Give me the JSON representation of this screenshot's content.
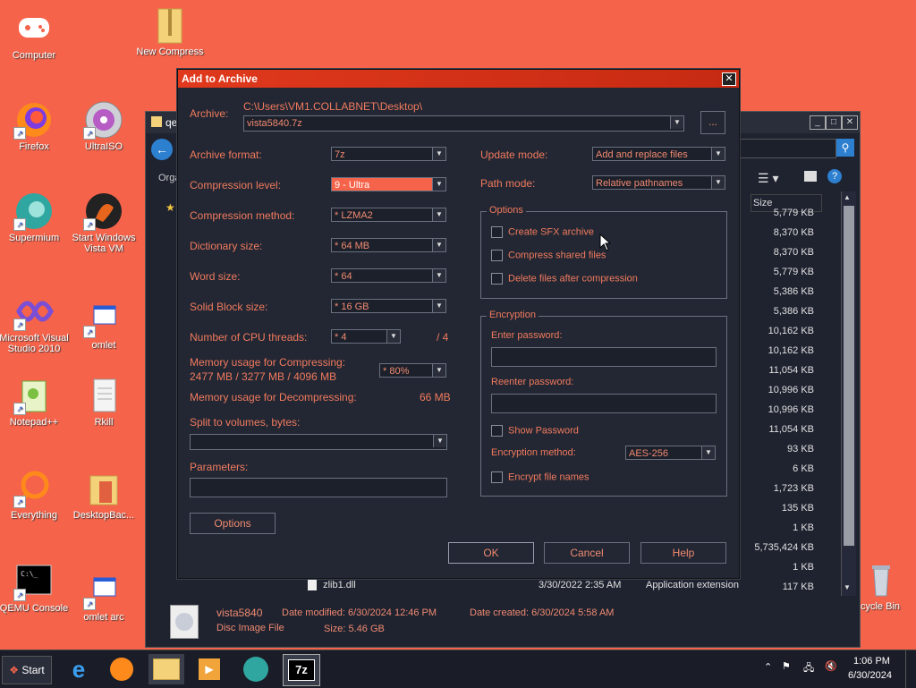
{
  "desktop": {
    "icons": [
      {
        "label": "Computer"
      },
      {
        "label": "New Compress"
      },
      {
        "label": "Firefox"
      },
      {
        "label": "UltraISO"
      },
      {
        "label": "Supermium"
      },
      {
        "label": "Start Windows Vista VM"
      },
      {
        "label": "Microsoft Visual Studio 2010"
      },
      {
        "label": "omlet"
      },
      {
        "label": "Notepad++"
      },
      {
        "label": "Rkill"
      },
      {
        "label": "Everything"
      },
      {
        "label": "DesktopBac..."
      },
      {
        "label": "QEMU Console"
      },
      {
        "label": "omlet arc"
      },
      {
        "label": "cycle Bin"
      }
    ]
  },
  "explorer": {
    "title": "qe",
    "column_size": "Size",
    "sizes": [
      "5,779 KB",
      "8,370 KB",
      "8,370 KB",
      "5,779 KB",
      "5,386 KB",
      "5,386 KB",
      "10,162 KB",
      "10,162 KB",
      "11,054 KB",
      "10,996 KB",
      "10,996 KB",
      "11,054 KB",
      "93 KB",
      "6 KB",
      "1,723 KB",
      "135 KB",
      "1 KB",
      "5,735,424 KB",
      "1 KB",
      "117 KB"
    ],
    "row_name": "zlib1.dll",
    "row_date": "3/30/2022 2:35 AM",
    "row_type": "Application extension",
    "details": {
      "name": "vista5840",
      "type": "Disc Image File",
      "modified": "Date modified: 6/30/2024 12:46 PM",
      "created": "Date created: 6/30/2024 5:58 AM",
      "size": "Size: 5.46 GB"
    },
    "nav_label": "Orga"
  },
  "dialog": {
    "title": "Add to Archive",
    "archive_label": "Archive:",
    "archive_path": "C:\\Users\\VM1.COLLABNET\\Desktop\\",
    "archive_name": "vista5840.7z",
    "browse_label": "...",
    "format_label": "Archive format:",
    "format_value": "7z",
    "level_label": "Compression level:",
    "level_value": "9 - Ultra",
    "method_label": "Compression method:",
    "method_value": "* LZMA2",
    "dict_label": "Dictionary size:",
    "dict_value": "* 64 MB",
    "word_label": "Word size:",
    "word_value": "* 64",
    "solid_label": "Solid Block size:",
    "solid_value": "* 16 GB",
    "threads_label": "Number of CPU threads:",
    "threads_value": "* 4",
    "threads_max": "/ 4",
    "mem_comp_label": "Memory usage for Compressing:",
    "mem_comp_value": "2477 MB / 3277 MB / 4096 MB",
    "mem_comp_pct": "* 80%",
    "mem_decomp_label": "Memory usage for Decompressing:",
    "mem_decomp_value": "66 MB",
    "split_label": "Split to volumes, bytes:",
    "params_label": "Parameters:",
    "options_btn": "Options",
    "update_label": "Update mode:",
    "update_value": "Add and replace files",
    "path_label": "Path mode:",
    "path_value": "Relative pathnames",
    "options_group": "Options",
    "opt_sfx": "Create SFX archive",
    "opt_shared": "Compress shared files",
    "opt_delete": "Delete files after compression",
    "enc_group": "Encryption",
    "enter_pw": "Enter password:",
    "reenter_pw": "Reenter password:",
    "show_pw": "Show Password",
    "enc_method_label": "Encryption method:",
    "enc_method_value": "AES-256",
    "enc_names": "Encrypt file names",
    "ok": "OK",
    "cancel": "Cancel",
    "help": "Help"
  },
  "taskbar": {
    "start": "Start",
    "time": "1:06 PM",
    "date": "6/30/2024",
    "app_7z": "7z"
  }
}
